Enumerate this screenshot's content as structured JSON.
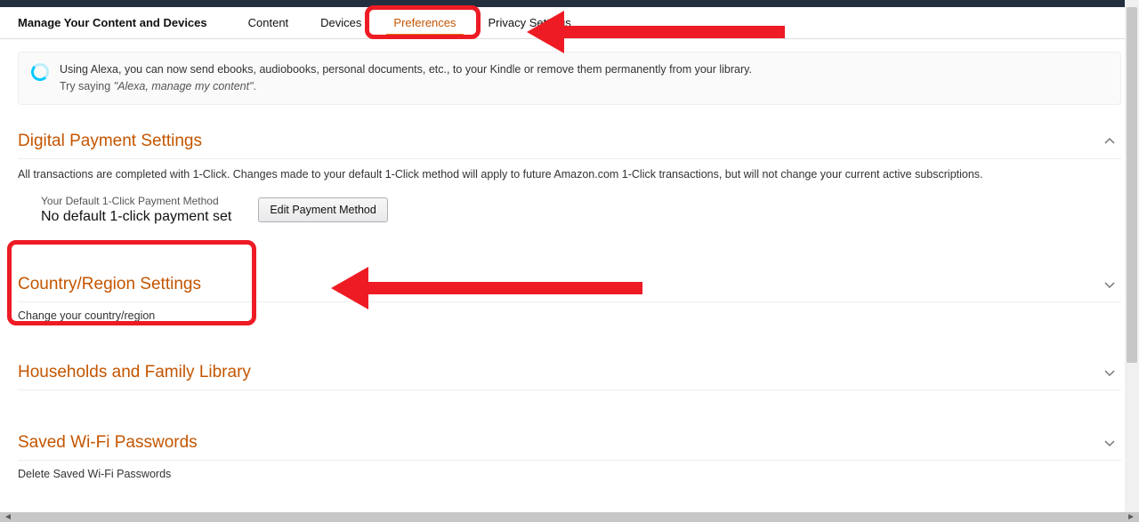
{
  "nav": {
    "title": "Manage Your Content and Devices",
    "tabs": [
      {
        "label": "Content"
      },
      {
        "label": "Devices"
      },
      {
        "label": "Preferences"
      },
      {
        "label": "Privacy Settings"
      }
    ]
  },
  "alexa": {
    "line1": "Using Alexa, you can now send ebooks, audiobooks, personal documents, etc., to your Kindle or remove them permanently from your library.",
    "line2_prefix": "Try saying ",
    "line2_quote": "\"Alexa, manage my content\"",
    "line2_suffix": "."
  },
  "sections": {
    "digital_payment": {
      "title": "Digital Payment Settings",
      "desc": "All transactions are completed with 1-Click. Changes made to your default 1-Click method will apply to future Amazon.com 1-Click transactions, but will not change your current active subscriptions.",
      "label_small": "Your Default 1-Click Payment Method",
      "value": "No default 1-click payment set",
      "button": "Edit Payment Method"
    },
    "country_region": {
      "title": "Country/Region Settings",
      "desc": "Change your country/region"
    },
    "households": {
      "title": "Households and Family Library"
    },
    "wifi": {
      "title": "Saved Wi-Fi Passwords",
      "desc": "Delete Saved Wi-Fi Passwords"
    }
  }
}
